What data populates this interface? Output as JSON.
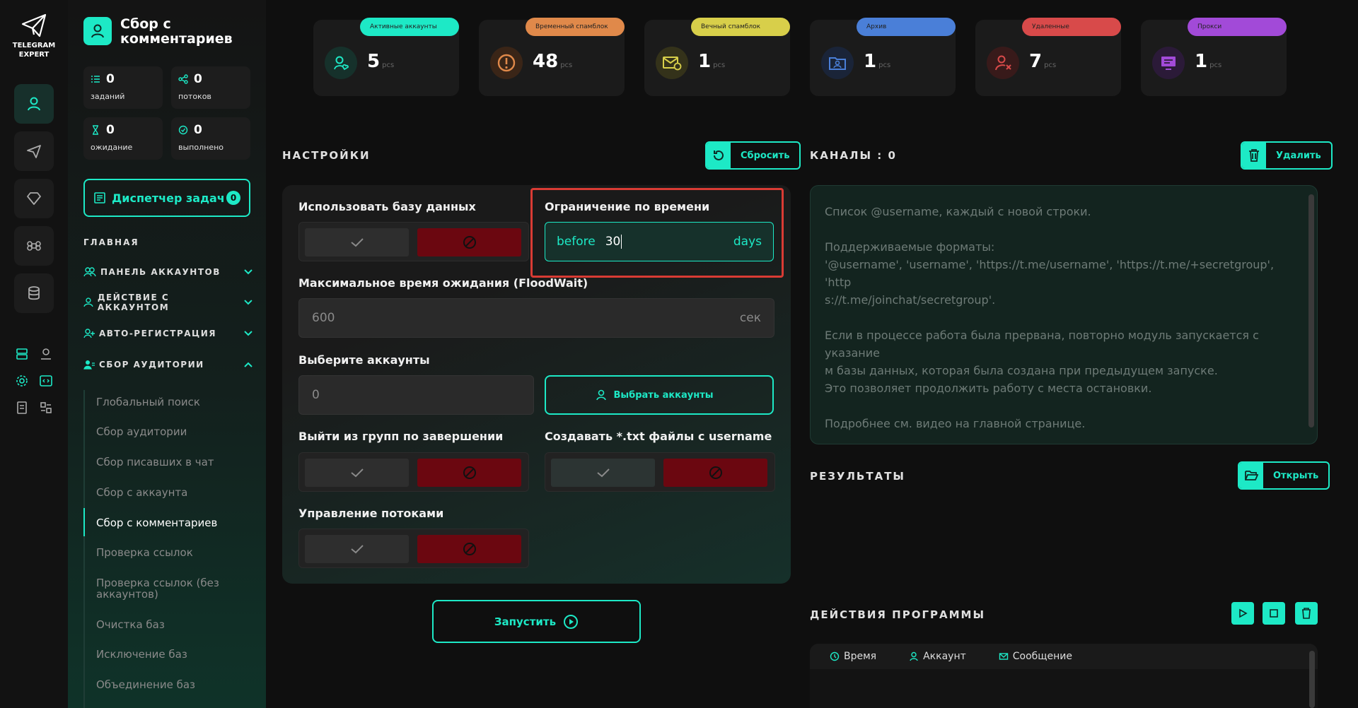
{
  "brand": {
    "line1": "TELEGRAM",
    "line2": "EXPERT"
  },
  "sidebar": {
    "title": "Сбор с комментариев",
    "stats": [
      {
        "value": "0",
        "label": "заданий"
      },
      {
        "value": "0",
        "label": "потоков"
      },
      {
        "value": "0",
        "label": "ожидание"
      },
      {
        "value": "0",
        "label": "выполнено"
      }
    ],
    "dispatcher": {
      "label": "Диспетчер задач",
      "badge": "0"
    },
    "section": "ГЛАВНАЯ",
    "groups": [
      "ПАНЕЛЬ АККАУНТОВ",
      "ДЕЙСТВИЕ С АККАУНТОМ",
      "АВТО-РЕГИСТРАЦИЯ",
      "СБОР АУДИТОРИИ"
    ],
    "items": [
      "Глобальный поиск",
      "Сбор аудитории",
      "Сбор писавших в чат",
      "Сбор с аккаунта",
      "Сбор с комментариев",
      "Проверка ссылок",
      "Проверка ссылок (без аккаунтов)",
      "Очистка баз",
      "Исключение баз",
      "Объединение баз"
    ],
    "active_item": "Сбор с комментариев"
  },
  "cards": [
    {
      "pill": "Активные аккаунты",
      "value": "5",
      "unit": "pcs",
      "color": "#1de9c6"
    },
    {
      "pill": "Временный спамблок",
      "value": "48",
      "unit": "pcs",
      "color": "#e0894a"
    },
    {
      "pill": "Вечный спамблок",
      "value": "1",
      "unit": "pcs",
      "color": "#d8cf4a"
    },
    {
      "pill": "Архив",
      "value": "1",
      "unit": "pcs",
      "color": "#4a7fd8"
    },
    {
      "pill": "Удаленные",
      "value": "7",
      "unit": "pcs",
      "color": "#d84a4a"
    },
    {
      "pill": "Прокси",
      "value": "1",
      "unit": "pcs",
      "color": "#a24ad8"
    }
  ],
  "settings": {
    "title": "НАСТРОЙКИ",
    "reset": "Сбросить",
    "use_db": "Использовать базу данных",
    "time_limit": "Ограничение по времени",
    "time_prefix": "before",
    "time_value": "30",
    "time_suffix": "days",
    "floodwait": "Максимальное время ожидания (FloodWait)",
    "floodwait_placeholder": "600",
    "floodwait_unit": "сек",
    "select_accounts": "Выберите аккаунты",
    "accounts_placeholder": "0",
    "select_accounts_btn": "Выбрать аккаунты",
    "leave_groups": "Выйти из групп по завершении",
    "create_txt": "Создавать *.txt файлы с username",
    "threads": "Управление потоками",
    "run": "Запустить"
  },
  "channels": {
    "title": "КАНАЛЫ : 0",
    "delete": "Удалить",
    "placeholder_lines": [
      "Список @username, каждый с новой строки.",
      "",
      "Поддерживаемые форматы:",
      "'@username', 'username', 'https://t.me/username', 'https://t.me/+secretgroup', 'http",
      "s://t.me/joinchat/secretgroup'.",
      "",
      "Если в процессе работа была прервана, повторно модуль запускается с указание",
      "м базы данных, которая была создана при предыдущем запуске.",
      "Это позволяет продолжить работу с места остановки.",
      "",
      "Подробнее см. видео на главной странице."
    ]
  },
  "results": {
    "title": "РЕЗУЛЬТАТЫ",
    "open": "Открыть"
  },
  "actions": {
    "title": "ДЕЙСТВИЯ ПРОГРАММЫ",
    "cols": [
      "Время",
      "Аккаунт",
      "Сообщение"
    ]
  }
}
